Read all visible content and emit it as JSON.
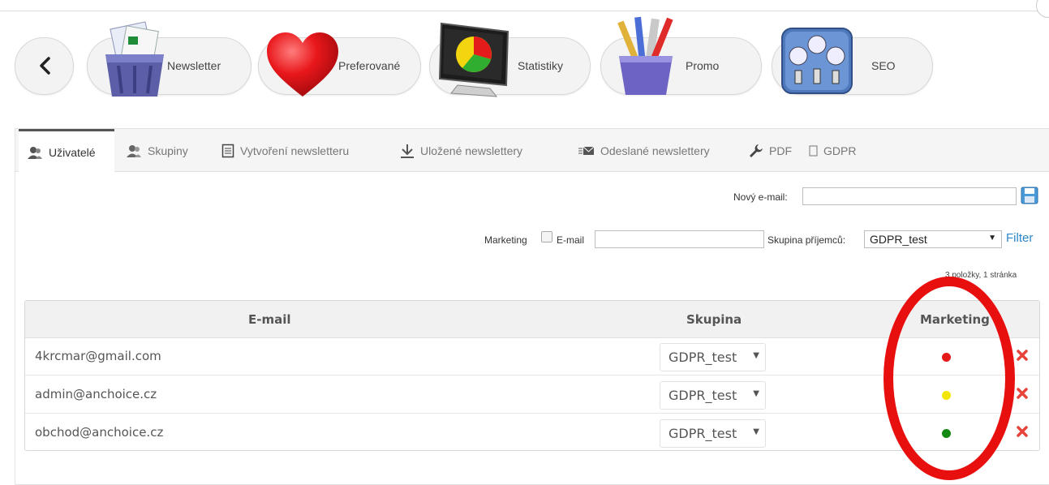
{
  "modules": [
    {
      "label": "Newsletter",
      "icon": "recycle-bin-newsletter-icon"
    },
    {
      "label": "Preferované",
      "icon": "heart-icon"
    },
    {
      "label": "Statistiky",
      "icon": "pie-chart-monitor-icon"
    },
    {
      "label": "Promo",
      "icon": "pencil-cup-icon"
    },
    {
      "label": "SEO",
      "icon": "gauges-icon"
    }
  ],
  "tabs": [
    {
      "label": "Uživatelé",
      "icon": "users-icon",
      "active": true
    },
    {
      "label": "Skupiny",
      "icon": "group-icon"
    },
    {
      "label": "Vytvoření newsletteru",
      "icon": "document-icon"
    },
    {
      "label": "Uložené newslettery",
      "icon": "download-icon"
    },
    {
      "label": "Odeslané newslettery",
      "icon": "envelope-icon"
    },
    {
      "label": "PDF",
      "icon": "wrench-icon"
    },
    {
      "label": "GDPR",
      "icon": "box-icon"
    }
  ],
  "new_email": {
    "label": "Nový e-mail:",
    "value": ""
  },
  "filter": {
    "marketing_label": "Marketing",
    "email_label": "E-mail",
    "email_value": "",
    "group_label": "Skupina příjemců:",
    "group_value": "GDPR_test",
    "filter_link": "Filter"
  },
  "pager": "3 položky, 1 stránka",
  "table": {
    "headers": {
      "email": "E-mail",
      "group": "Skupina",
      "marketing": "Marketing"
    },
    "rows": [
      {
        "email": "4krcmar@gmail.com",
        "group": "GDPR_test",
        "marketing_color": "#e41a1a"
      },
      {
        "email": "admin@anchoice.cz",
        "group": "GDPR_test",
        "marketing_color": "#f2e600"
      },
      {
        "email": "obchod@anchoice.cz",
        "group": "GDPR_test",
        "marketing_color": "#138a13"
      }
    ]
  },
  "colors": {
    "accent_link": "#2e86c8",
    "delete": "#e8433a",
    "highlight_oval": "#e80f0f"
  }
}
